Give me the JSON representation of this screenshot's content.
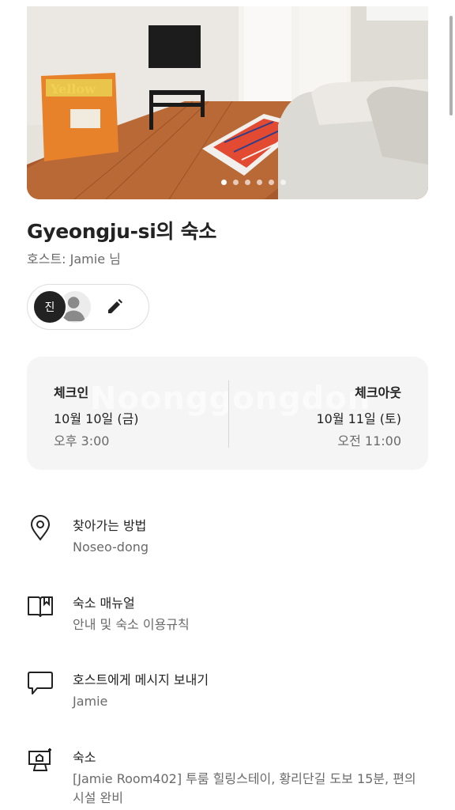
{
  "listing": {
    "title": "Gyeongju-si의 숙소",
    "host_line": "호스트: Jamie 님",
    "photo_count": 6,
    "active_photo_index": 0
  },
  "guests": {
    "avatar_initial": "진"
  },
  "checkin": {
    "heading": "체크인",
    "date": "10월 10일 (금)",
    "time": "오후 3:00"
  },
  "checkout": {
    "heading": "체크아웃",
    "date": "10월 11일 (토)",
    "time": "오전 11:00"
  },
  "watermark": "Noonggongdon",
  "rows": [
    {
      "icon": "map-pin-icon",
      "label": "찾아가는 방법",
      "sub": "Noseo-dong"
    },
    {
      "icon": "book-icon",
      "label": "숙소 매뉴얼",
      "sub": "안내 및 숙소 이용규칙"
    },
    {
      "icon": "chat-bubble-icon",
      "label": "호스트에게 메시지 보내기",
      "sub": "Jamie"
    },
    {
      "icon": "house-icon",
      "label": "숙소",
      "sub": "[Jamie Room402] 투룸 힐링스테이, 황리단길 도보 15분, 편의시설 완비"
    }
  ]
}
